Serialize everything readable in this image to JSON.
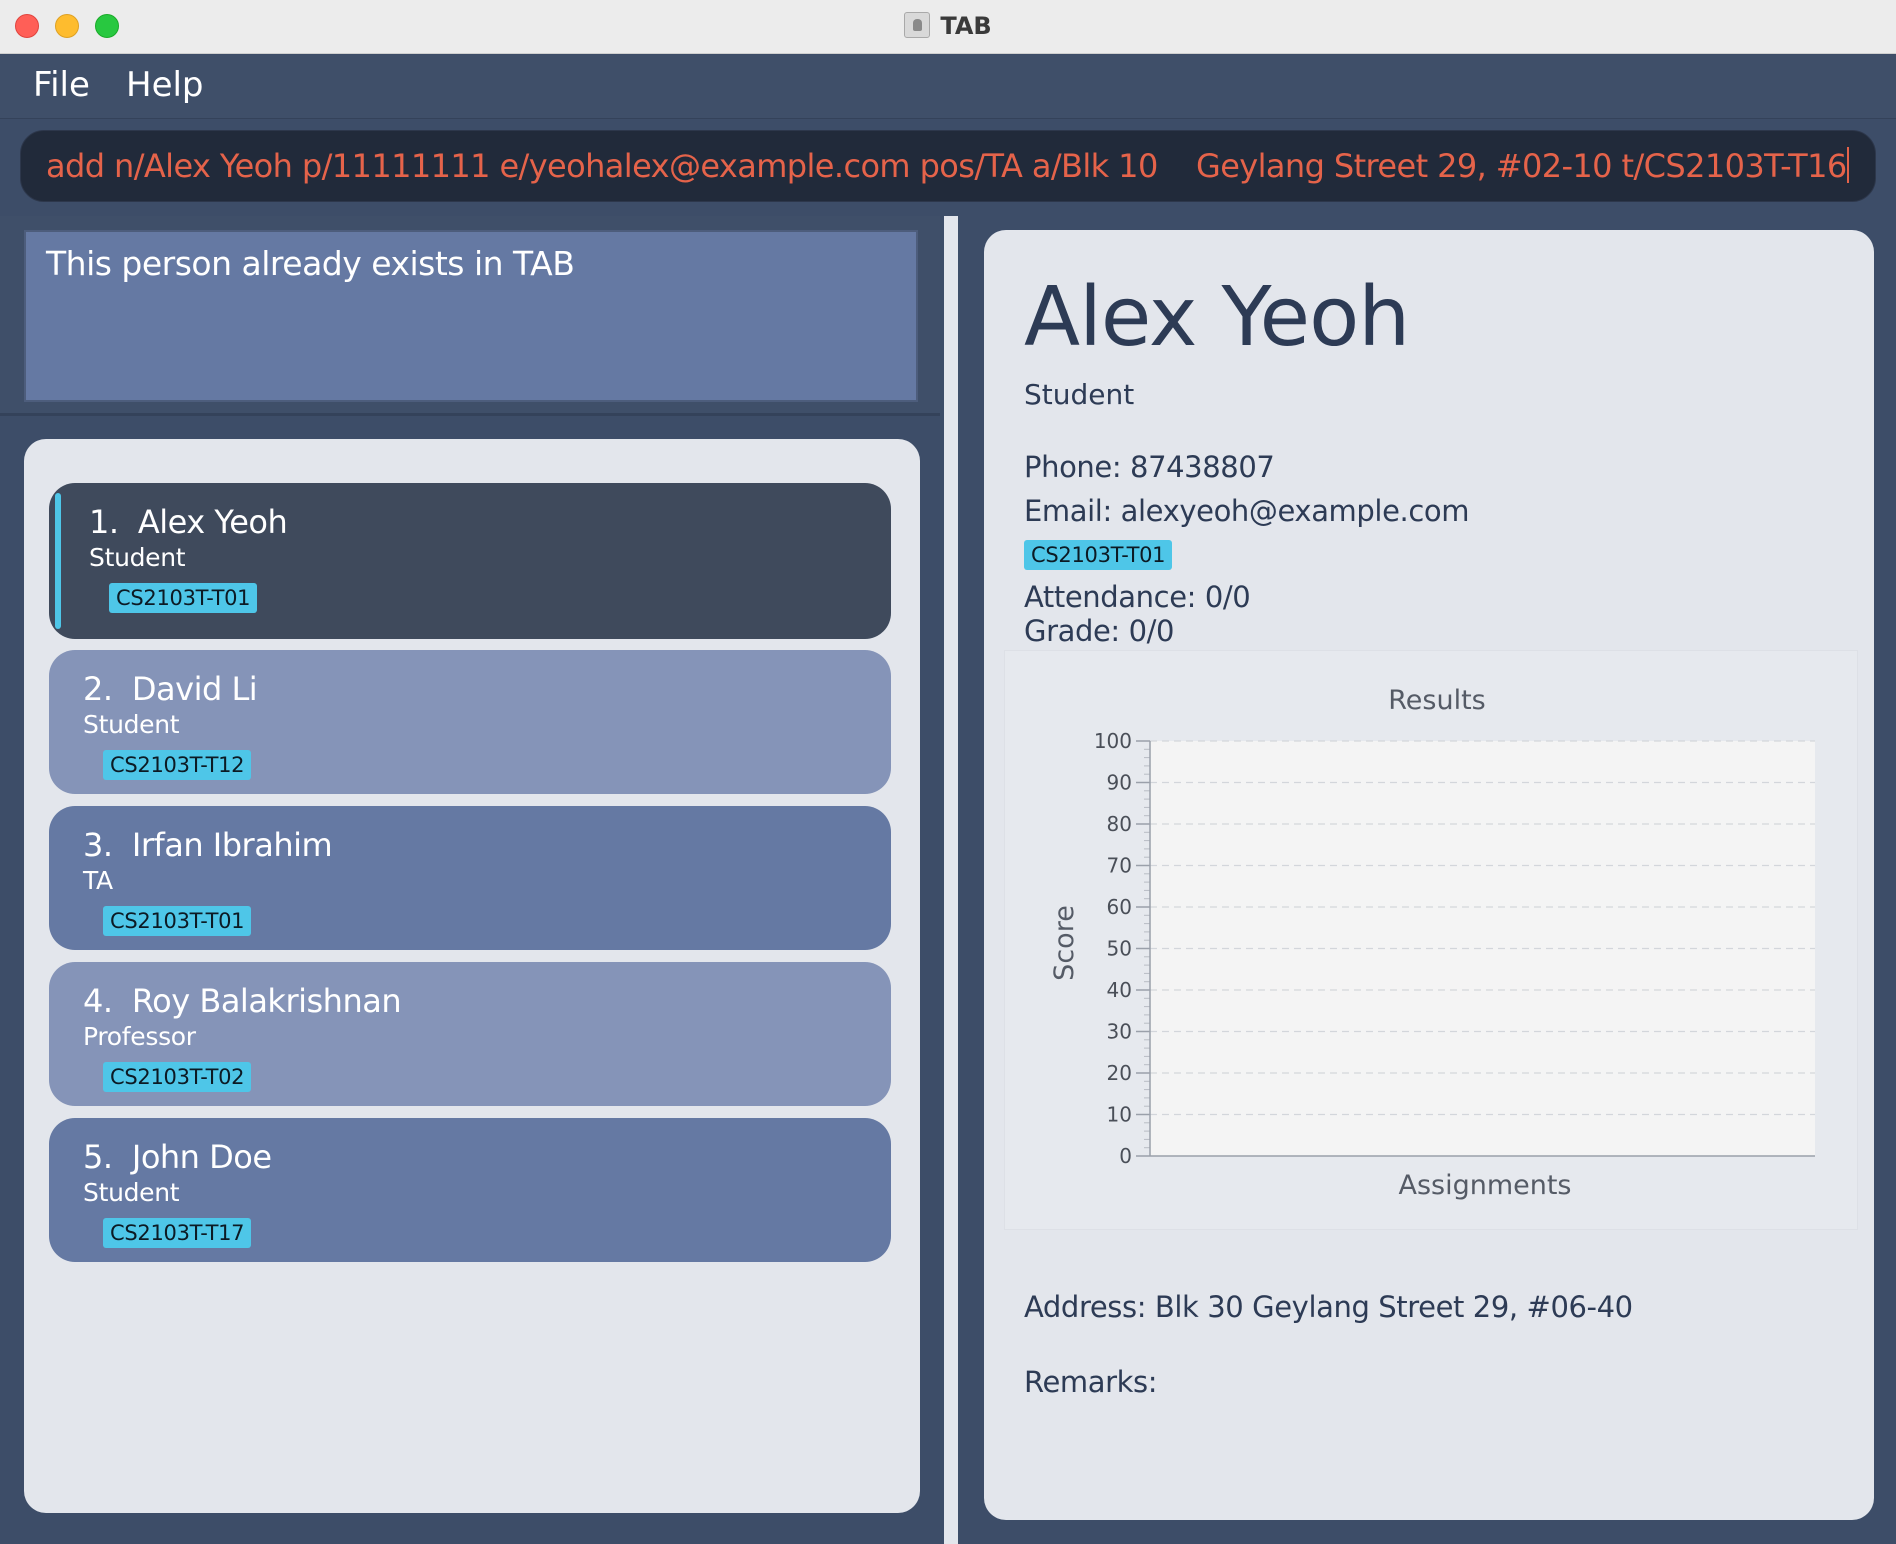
{
  "window": {
    "title": "TAB"
  },
  "menu": {
    "file": "File",
    "help": "Help"
  },
  "command": {
    "text": "add n/Alex Yeoh p/11111111 e/yeohalex@example.com pos/TA a/Blk 10    Geylang Street 29, #02-10 t/CS2103T-T16"
  },
  "result": {
    "message": "This person already exists in TAB"
  },
  "persons": [
    {
      "index": "1.",
      "name": "Alex Yeoh",
      "role": "Student",
      "tag": "CS2103T-T01"
    },
    {
      "index": "2.",
      "name": "David Li",
      "role": "Student",
      "tag": "CS2103T-T12"
    },
    {
      "index": "3.",
      "name": "Irfan Ibrahim",
      "role": "TA",
      "tag": "CS2103T-T01"
    },
    {
      "index": "4.",
      "name": "Roy Balakrishnan",
      "role": "Professor",
      "tag": "CS2103T-T02"
    },
    {
      "index": "5.",
      "name": "John Doe",
      "role": "Student",
      "tag": "CS2103T-T17"
    }
  ],
  "detail": {
    "name": "Alex Yeoh",
    "role": "Student",
    "phone": "Phone: 87438807",
    "email": "Email: alexyeoh@example.com",
    "tag": "CS2103T-T01",
    "attendance": "Attendance: 0/0",
    "grade": "Grade: 0/0",
    "address": "Address: Blk 30 Geylang Street 29, #06-40",
    "remarks": "Remarks:"
  },
  "chart_data": {
    "type": "line",
    "title": "Results",
    "xlabel": "Assignments",
    "ylabel": "Score",
    "ylim": [
      0,
      100
    ],
    "yticks": [
      "0",
      "10",
      "20",
      "30",
      "40",
      "50",
      "60",
      "70",
      "80",
      "90",
      "100"
    ],
    "categories": [],
    "series": [],
    "grid": true
  },
  "colors": {
    "accent_tag": "#4ec6e8",
    "command_text": "#e5634a",
    "selected_card": "#3f4a5c"
  }
}
